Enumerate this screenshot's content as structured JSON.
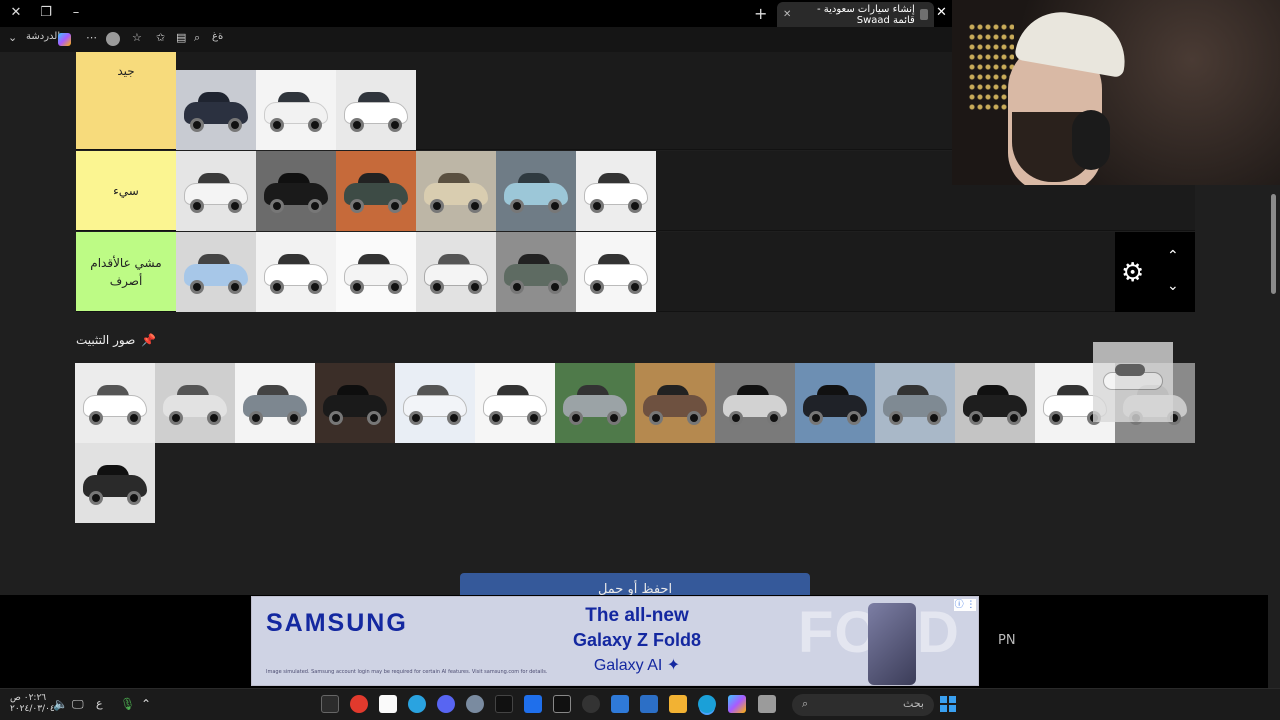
{
  "browser": {
    "tab_title": "إنشاء سيارات سعودية - قائمة Swaad",
    "new_tab_symbol": "+",
    "close_symbol": "✕",
    "toolbar": {
      "chat_label": "الدردشة",
      "reader_label": "ةغ"
    }
  },
  "tiers": [
    {
      "label": "جيد",
      "color": "#f7db7c",
      "car_count": 3
    },
    {
      "label": "سيء",
      "color": "#fbf591",
      "car_count": 6
    },
    {
      "label": "مشي عالأقدام أصرف",
      "color": "#bdfb85",
      "car_count": 6
    }
  ],
  "pinned": {
    "title": "صور التثبيت",
    "pin_icon": "📌",
    "car_count": 14
  },
  "save_button": {
    "label": "احفظ أو حمل"
  },
  "ad": {
    "brand": "SAMSUNG",
    "headline_1": "The all-new",
    "headline_2": "Galaxy Z Fold8",
    "headline_3": "Galaxy AI ✦",
    "fine_print": "Image simulated. Samsung account login may be required for certain AI features. Visit samsung.com for details.",
    "watermark": "FOLD",
    "info": "ⓘ ⋮"
  },
  "side_text": "PN",
  "taskbar": {
    "search_placeholder": "بحث",
    "language": "ع",
    "clock_time": "٠٢:٢٦ ص",
    "clock_date": "٢٠٢٤/٠٣/٠٤"
  }
}
